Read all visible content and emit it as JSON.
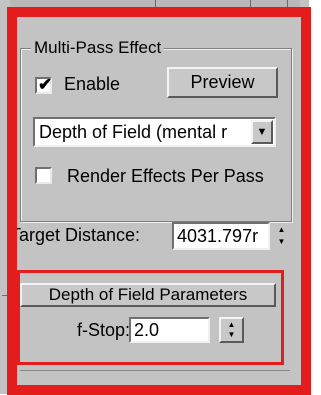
{
  "multipass": {
    "title": "Multi-Pass Effect",
    "enable_label": "Enable",
    "enable_mark": "✔",
    "preview_label": "Preview",
    "effect_selected": "Depth of Field (mental r",
    "render_effects_label": "Render Effects Per Pass"
  },
  "target": {
    "label": "Target Distance:",
    "value": "4031.797r"
  },
  "dof": {
    "title": "Depth of Field Parameters",
    "fstop_label": "f-Stop:",
    "fstop_value": "2.0"
  },
  "icons": {
    "dropdown": "chevron-down-icon",
    "spinner_up": "spinner-up-icon",
    "spinner_down": "spinner-down-icon"
  },
  "colors": {
    "highlight": "#e41c1c",
    "panel": "#c3c3c3"
  }
}
